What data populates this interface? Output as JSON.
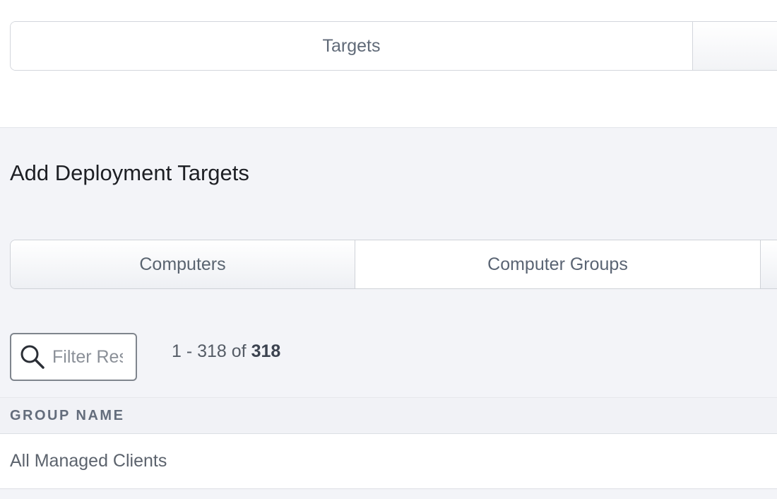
{
  "top_tabs": {
    "active_label": "Targets"
  },
  "section": {
    "title": "Add Deployment Targets"
  },
  "sub_tabs": {
    "computers_label": "Computers",
    "groups_label": "Computer Groups"
  },
  "filter": {
    "placeholder": "Filter Results",
    "value": ""
  },
  "pager": {
    "range": "1 - 318 of ",
    "total": "318"
  },
  "table": {
    "columns": [
      "GROUP NAME"
    ],
    "rows": [
      {
        "group_name": "All Managed Clients"
      }
    ]
  },
  "icons": {
    "search": "search-icon"
  }
}
